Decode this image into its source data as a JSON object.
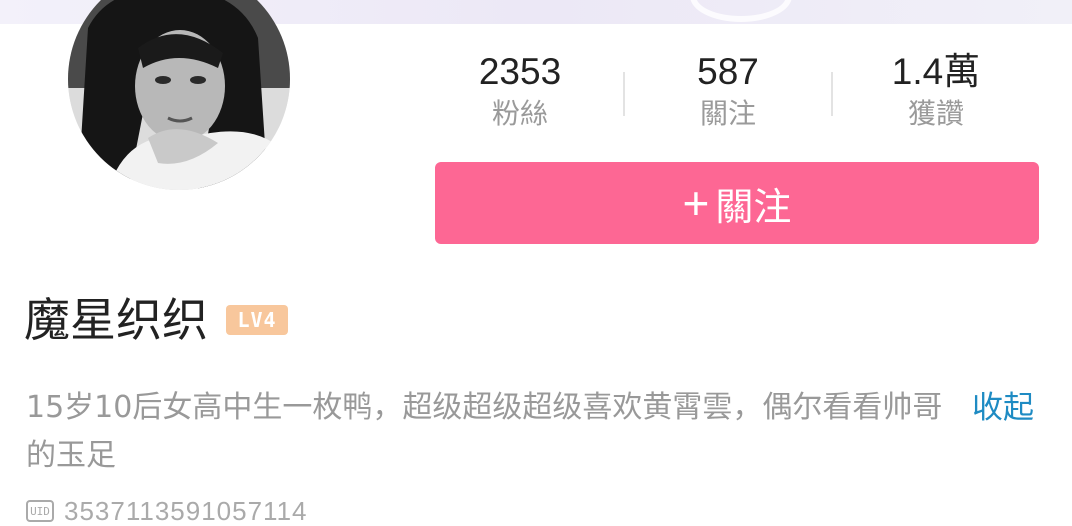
{
  "stats": [
    {
      "value": "2353",
      "label": "粉絲"
    },
    {
      "value": "587",
      "label": "關注"
    },
    {
      "value": "1.4萬",
      "label": "獲讚"
    }
  ],
  "follow_button": {
    "plus": "+",
    "label": "關注"
  },
  "profile": {
    "name": "魔星织织",
    "level": "LV4",
    "bio": "15岁10后女高中生一枚鸭，超级超级超级喜欢黄霄雲，偶尔看看帅哥的玉足",
    "collapse_label": "收起",
    "uid_icon": "UID",
    "uid": "3537113591057114"
  },
  "colors": {
    "accent": "#fd6794",
    "link": "#1e8bc3",
    "level_badge": "#f8c79c"
  }
}
